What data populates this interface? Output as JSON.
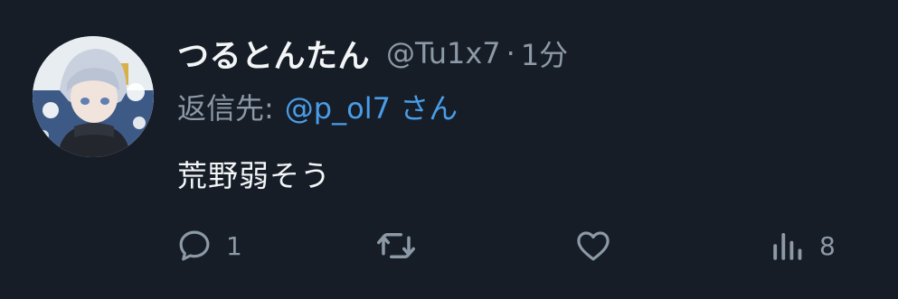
{
  "tweet": {
    "display_name": "つるとんたん",
    "handle": "@Tu1x7",
    "separator": "·",
    "time": "1分",
    "reply_prefix": "返信先:",
    "reply_target": "@p_ol7 さん",
    "text": "荒野弱そう"
  },
  "actions": {
    "reply": {
      "icon": "reply-icon",
      "count": "1"
    },
    "retweet": {
      "icon": "retweet-icon"
    },
    "like": {
      "icon": "heart-icon"
    },
    "views": {
      "icon": "views-icon",
      "count": "8"
    }
  },
  "colors": {
    "background": "#161d27",
    "primary_text": "#f3f5f7",
    "secondary_text": "#8c99a6",
    "link": "#4a9de8",
    "icon": "#8c99a6"
  }
}
